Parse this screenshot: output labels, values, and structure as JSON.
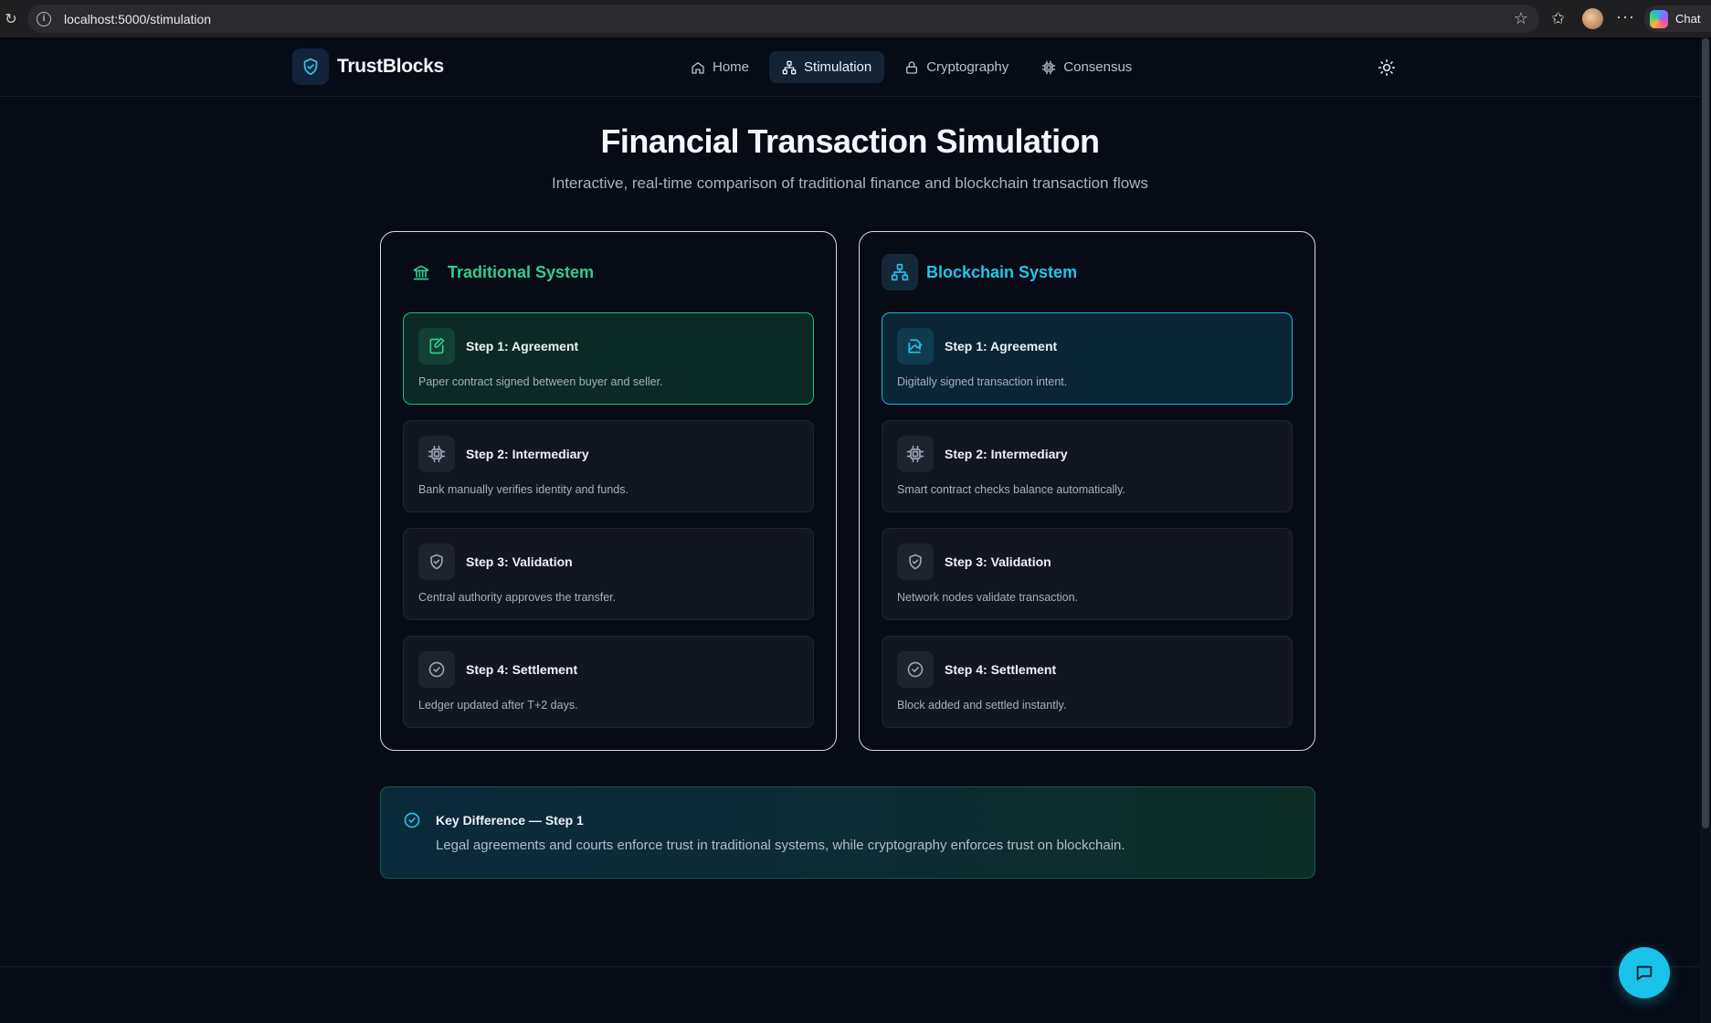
{
  "browser": {
    "url": "localhost:5000/stimulation",
    "chat_label": "Chat"
  },
  "app": {
    "brand": "TrustBlocks",
    "nav": [
      {
        "label": "Home",
        "icon": "home-icon"
      },
      {
        "label": "Stimulation",
        "icon": "network-icon",
        "active": true
      },
      {
        "label": "Cryptography",
        "icon": "lock-icon"
      },
      {
        "label": "Consensus",
        "icon": "cpu-icon"
      }
    ],
    "theme_toggle_icon": "sun-icon"
  },
  "hero": {
    "title": "Financial Transaction Simulation",
    "subtitle": "Interactive, real-time comparison of traditional finance and blockchain transaction flows"
  },
  "traditional": {
    "title": "Traditional System",
    "icon": "bank-icon",
    "accent": "#2ecf8a",
    "steps": [
      {
        "title": "Step 1: Agreement",
        "desc": "Paper contract signed between buyer and seller.",
        "icon": "edit-document-icon",
        "active": true
      },
      {
        "title": "Step 2: Intermediary",
        "desc": "Bank manually verifies identity and funds.",
        "icon": "cpu-icon"
      },
      {
        "title": "Step 3: Validation",
        "desc": "Central authority approves the transfer.",
        "icon": "shield-icon"
      },
      {
        "title": "Step 4: Settlement",
        "desc": "Ledger updated after T+2 days.",
        "icon": "check-circle-icon"
      }
    ]
  },
  "blockchain": {
    "title": "Blockchain System",
    "icon": "network-icon",
    "accent": "#1fc6ea",
    "steps": [
      {
        "title": "Step 1: Agreement",
        "desc": "Digitally signed transaction intent.",
        "icon": "signature-icon",
        "active": true
      },
      {
        "title": "Step 2: Intermediary",
        "desc": "Smart contract checks balance automatically.",
        "icon": "cpu-icon"
      },
      {
        "title": "Step 3: Validation",
        "desc": "Network nodes validate transaction.",
        "icon": "shield-icon"
      },
      {
        "title": "Step 4: Settlement",
        "desc": "Block added and settled instantly.",
        "icon": "check-circle-icon"
      }
    ]
  },
  "key_difference": {
    "title": "Key Difference — Step 1",
    "text": "Legal agreements and courts enforce trust in traditional systems, while cryptography enforces trust on blockchain."
  },
  "chat_fab_icon": "chat-bubble-icon"
}
